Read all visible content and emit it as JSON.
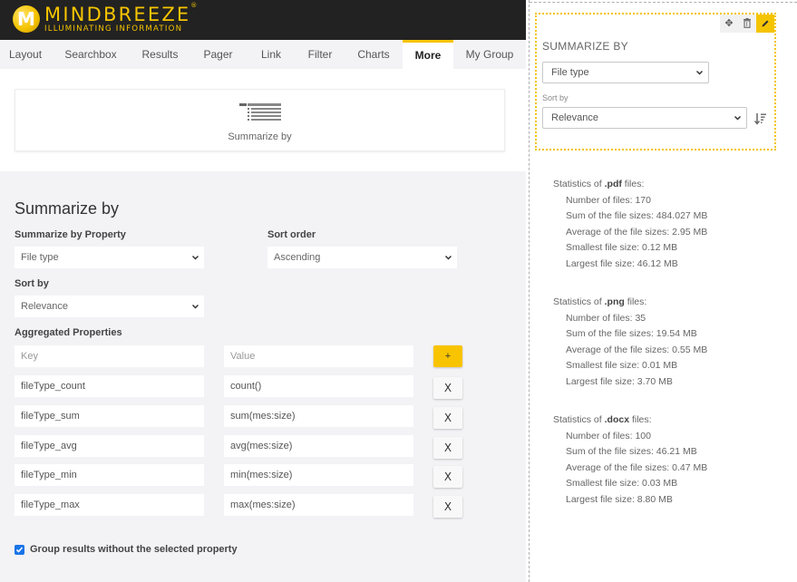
{
  "brand": {
    "name": "MINDBREEZE",
    "registered": "®",
    "tagline": "ILLUMINATING INFORMATION",
    "accent_color": "#f5c400"
  },
  "tabs": [
    {
      "label": "Layout",
      "active": false
    },
    {
      "label": "Searchbox",
      "active": false
    },
    {
      "label": "Results",
      "active": false
    },
    {
      "label": "Pager",
      "active": false
    },
    {
      "label": "Link",
      "active": false
    },
    {
      "label": "Filter",
      "active": false
    },
    {
      "label": "Charts",
      "active": false
    },
    {
      "label": "More",
      "active": true
    },
    {
      "label": "My Group",
      "active": false
    }
  ],
  "widget": {
    "icon": "summarize-list-icon",
    "label": "Summarize by"
  },
  "form": {
    "title": "Summarize by",
    "property_label": "Summarize by Property",
    "property_value": "File type",
    "sort_order_label": "Sort order",
    "sort_order_value": "Ascending",
    "sort_by_label": "Sort by",
    "sort_by_value": "Relevance",
    "aggregated_label": "Aggregated Properties",
    "key_placeholder": "Key",
    "value_placeholder": "Value",
    "add_label": "+",
    "remove_label": "X",
    "aggregated": [
      {
        "key": "fileType_count",
        "value": "count()"
      },
      {
        "key": "fileType_sum",
        "value": "sum(mes:size)"
      },
      {
        "key": "fileType_avg",
        "value": "avg(mes:size)"
      },
      {
        "key": "fileType_min",
        "value": "min(mes:size)"
      },
      {
        "key": "fileType_max",
        "value": "max(mes:size)"
      }
    ],
    "group_checkbox_label": "Group results without the selected property",
    "group_checkbox_checked": true
  },
  "preview": {
    "tools": [
      {
        "icon": "move-icon",
        "glyph": "✥"
      },
      {
        "icon": "trash-icon",
        "glyph": "🗑"
      },
      {
        "icon": "pencil-icon",
        "glyph": "✎"
      }
    ],
    "title": "SUMMARIZE BY",
    "property_value": "File type",
    "sort_by_label": "Sort by",
    "sort_by_value": "Relevance",
    "sort_icon": "sort-descending-icon"
  },
  "stats": [
    {
      "prefix": "Statistics of ",
      "type": ".pdf",
      "suffix": " files:",
      "lines": [
        "Number of files: 170",
        "Sum of the file sizes: 484.027 MB",
        "Average of the file sizes: 2.95 MB",
        "Smallest file size: 0.12 MB",
        "Largest file size: 46.12 MB"
      ]
    },
    {
      "prefix": "Statistics of ",
      "type": ".png",
      "suffix": " files:",
      "lines": [
        "Number of files: 35",
        "Sum of the file sizes: 19.54 MB",
        "Average of the file sizes: 0.55 MB",
        "Smallest file size: 0.01 MB",
        "Largest file size: 3.70 MB"
      ]
    },
    {
      "prefix": "Statistics of ",
      "type": ".docx",
      "suffix": " files:",
      "lines": [
        "Number of files: 100",
        "Sum of the file sizes: 46.21 MB",
        "Average of the file sizes: 0.47 MB",
        "Smallest file size: 0.03 MB",
        "Largest file size: 8.80 MB"
      ]
    }
  ]
}
